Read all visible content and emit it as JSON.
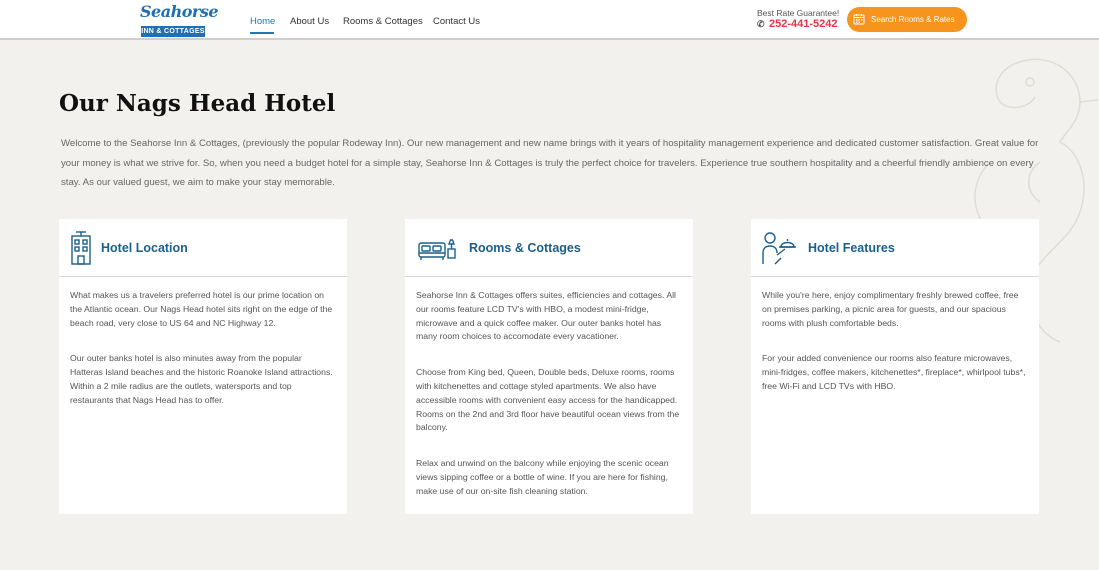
{
  "header": {
    "logo_word": "Seahorse",
    "logo_sub": "INN & COTTAGES",
    "nav": [
      {
        "label": "Home"
      },
      {
        "label": "About Us"
      },
      {
        "label": "Rooms & Cottages"
      },
      {
        "label": "Contact Us"
      }
    ],
    "rate_label": "Best Rate Guarantee!",
    "phone": "252-441-5242",
    "cta_label": "Search Rooms & Rates"
  },
  "main": {
    "title": "Our Nags Head Hotel",
    "intro": "Welcome to the Seahorse Inn & Cottages, (previously the popular Rodeway Inn). Our new management and new name brings with it years of hospitality management experience and dedicated customer satisfaction. Great value for your money is what we strive for. So, when you need a budget hotel for a simple stay, Seahorse Inn & Cottages is truly the perfect choice for travelers. Experience true southern hospitality and a cheerful friendly ambience on every stay. As our valued guest, we aim to make your stay memorable.",
    "cards": [
      {
        "title": "Hotel Location",
        "icon": "building-icon",
        "paragraphs": [
          "What makes us a travelers preferred hotel is our prime location on the Atlantic ocean. Our Nags Head hotel sits right on the edge of the beach road, very close to US 64 and NC Highway 12.",
          "Our outer banks hotel is also minutes away from the popular Hatteras Island beaches and the historic Roanoke Island attractions. Within a 2 mile radius are the outlets, watersports and top restaurants that Nags Head has to offer."
        ]
      },
      {
        "title": "Rooms & Cottages",
        "icon": "bed-icon",
        "paragraphs": [
          "Seahorse Inn & Cottages offers suites, efficiencies and cottages. All our rooms feature LCD TV's with HBO, a modest mini-fridge, microwave and a quick coffee maker. Our outer banks hotel has many room choices to accomodate every vacationer.",
          "Choose from King bed, Queen, Double beds, Deluxe rooms, rooms with kitchenettes and cottage styled apartments. We also have accessible rooms with convenient easy access for the handicapped. Rooms on the 2nd and 3rd floor have beautiful ocean views from the balcony.",
          "Relax and unwind on the balcony while enjoying the scenic ocean views sipping coffee or a bottle of wine. If you are here for fishing, make use of our on-site fish cleaning station."
        ]
      },
      {
        "title": "Hotel Features",
        "icon": "concierge-icon",
        "paragraphs": [
          "While you're here, enjoy complimentary freshly brewed coffee, free on premises parking, a picnic area for guests, and our spacious rooms with plush comfortable beds.",
          "For your added convenience our rooms also feature microwaves, mini-fridges, coffee makers, kitchenettes*, fireplace*, whirlpool tubs*, free Wi-Fi and LCD TVs with HBO."
        ]
      }
    ]
  },
  "colors": {
    "accent": "#1f78b4",
    "cta": "#f7941d",
    "phone": "#e8334a",
    "background": "#f3f1ee"
  }
}
